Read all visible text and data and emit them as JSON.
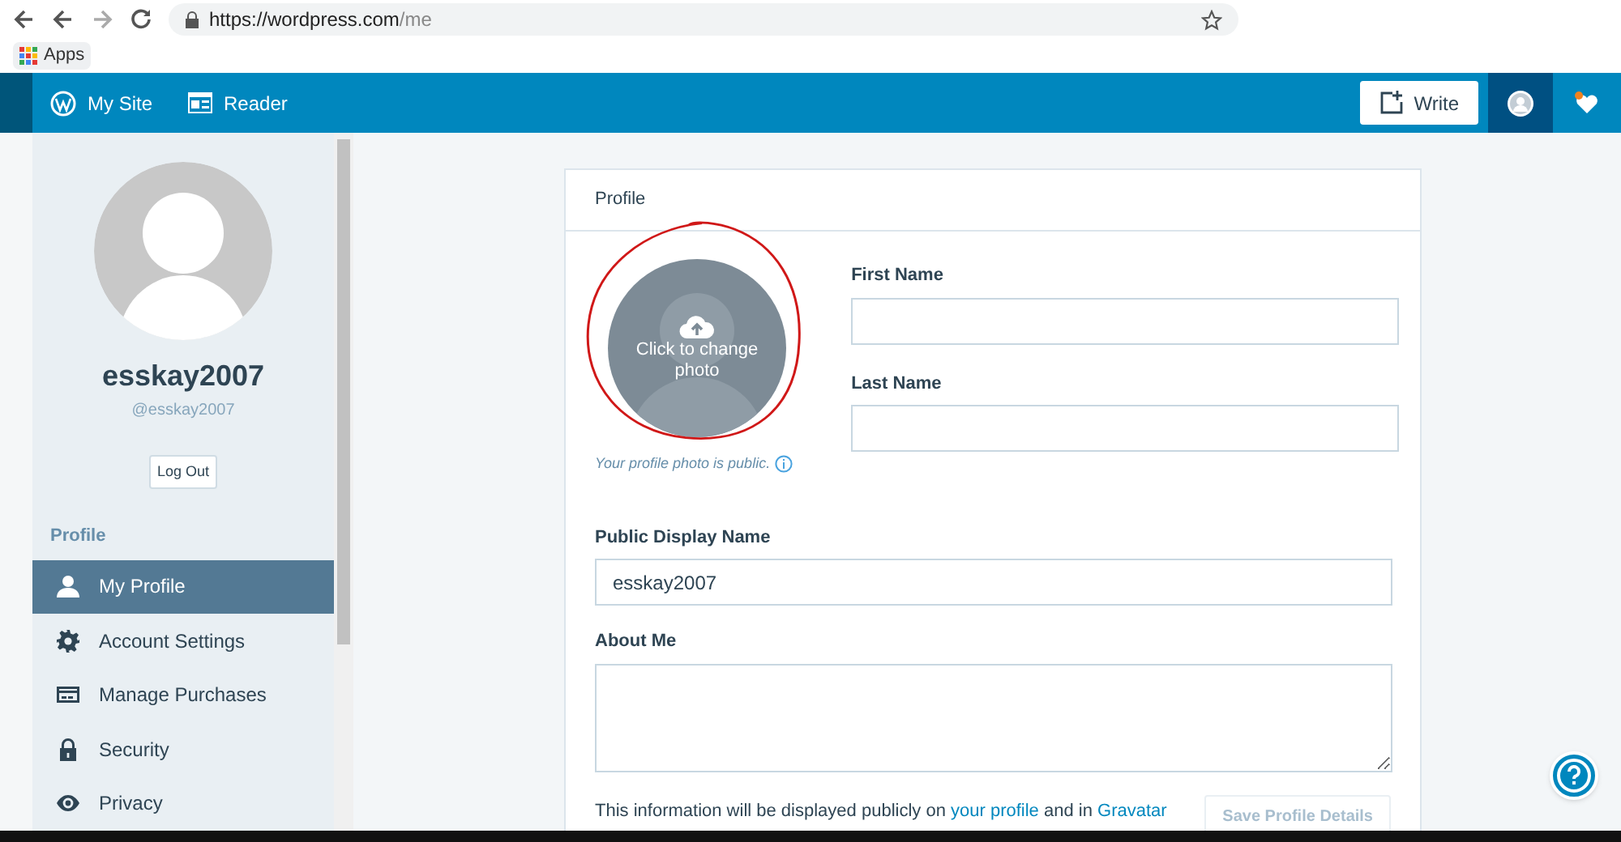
{
  "browser": {
    "url_host": "https://wordpress.com",
    "url_path": "/me",
    "bookmarks": [
      "Apps"
    ]
  },
  "masterbar": {
    "items": [
      {
        "kind": "site",
        "label": "My Site"
      },
      {
        "kind": "reader",
        "label": "Reader"
      }
    ],
    "write": "Write"
  },
  "sidebar": {
    "username": "esskay2007",
    "handle": "@esskay2007",
    "logout": "Log Out",
    "section": "Profile",
    "items": [
      {
        "kind": "person",
        "label": "My Profile",
        "selected": true
      },
      {
        "kind": "gear",
        "label": "Account Settings",
        "selected": false
      },
      {
        "kind": "card",
        "label": "Manage Purchases",
        "selected": false
      },
      {
        "kind": "lock",
        "label": "Security",
        "selected": false
      },
      {
        "kind": "eye",
        "label": "Privacy",
        "selected": false
      }
    ]
  },
  "profile": {
    "title": "Profile",
    "photo_label": "Click to change photo",
    "photo_note": "Your profile photo is public.",
    "name_fields": [
      {
        "label": "First Name"
      },
      {
        "label": "Last Name"
      }
    ],
    "display_name": {
      "label": "Public Display Name",
      "value": "esskay2007"
    },
    "about": {
      "label": "About Me"
    },
    "footer": [
      {
        "kind": "text",
        "text": "This information will be displayed publicly on "
      },
      {
        "kind": "link",
        "text": "your profile"
      },
      {
        "kind": "text",
        "text": " and in "
      },
      {
        "kind": "link",
        "text": "Gravatar"
      }
    ],
    "save": {
      "label": "Save Profile Details",
      "disabled": true
    }
  }
}
